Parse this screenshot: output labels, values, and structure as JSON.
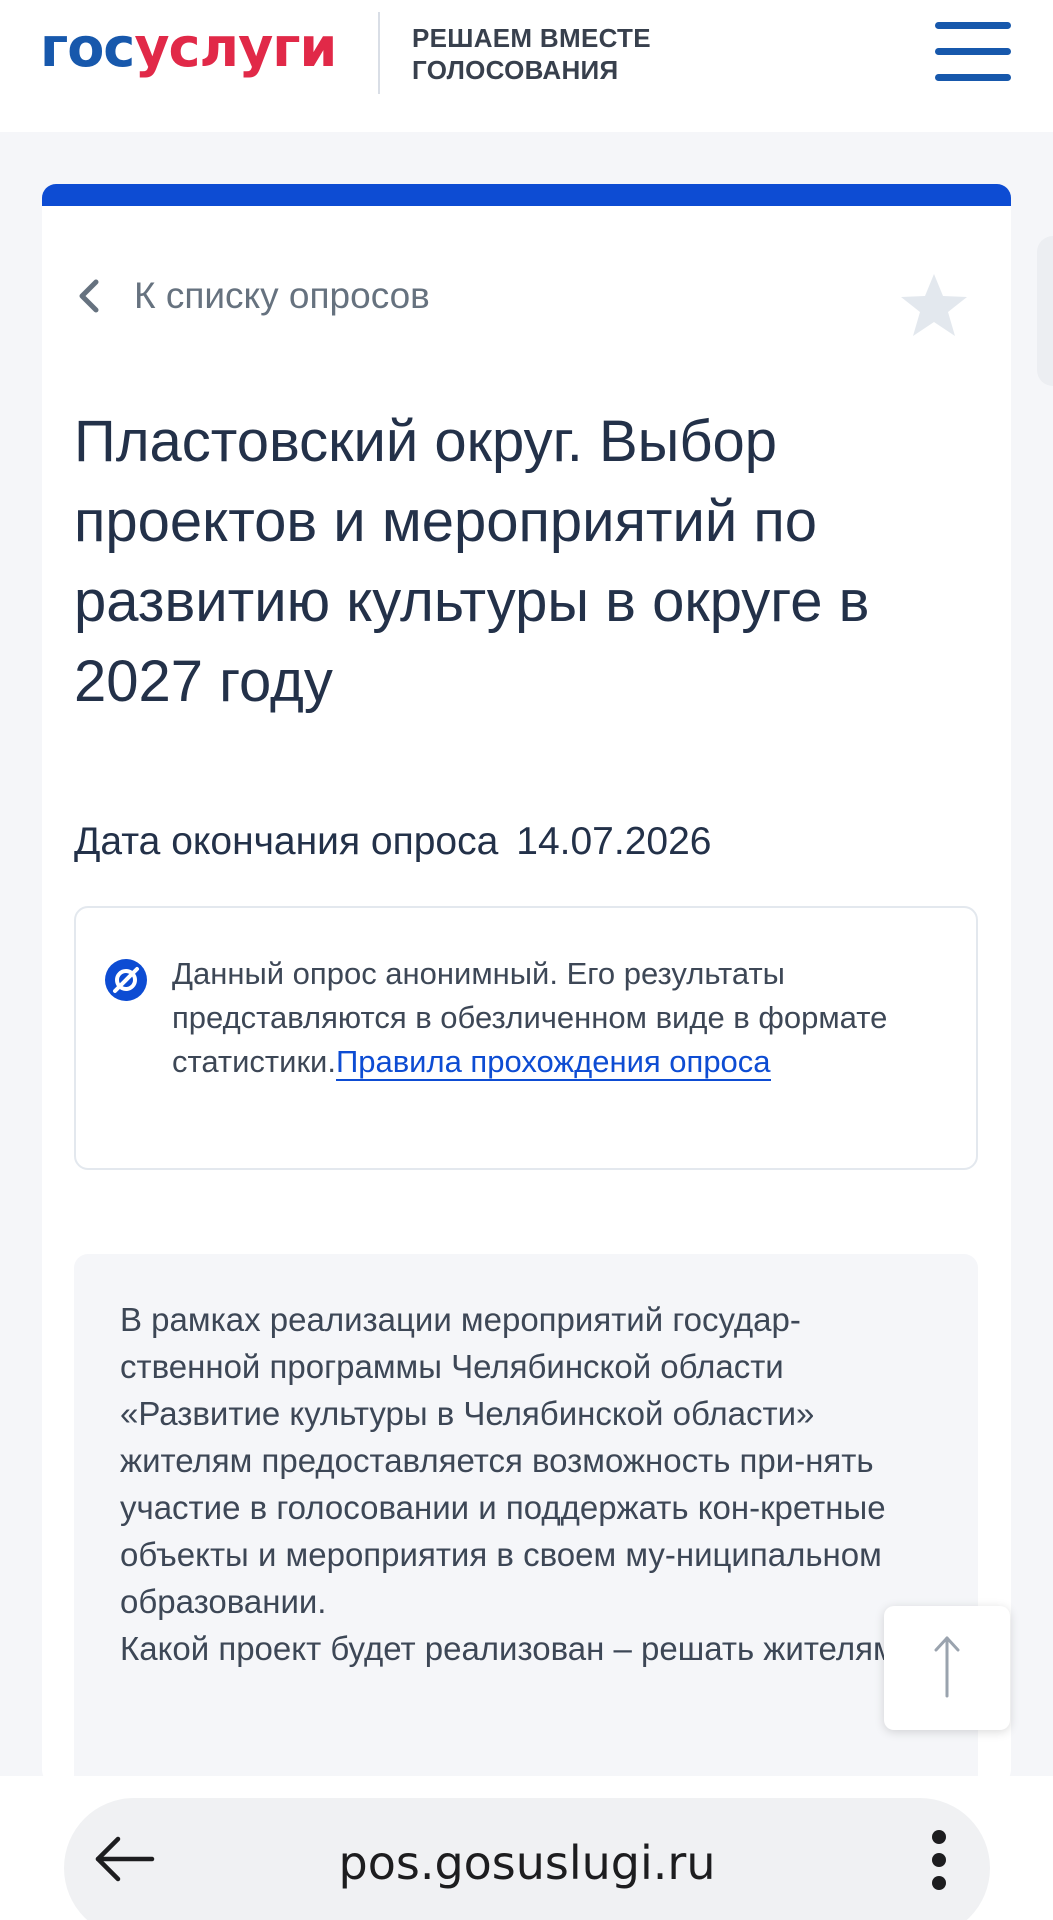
{
  "header": {
    "logo_part1": "гос",
    "logo_part2": "услуги",
    "tagline_line1": "РЕШАЕМ ВМЕСТЕ",
    "tagline_line2": "ГОЛОСОВАНИЯ"
  },
  "survey": {
    "back_label": "К списку опросов",
    "title": "Пластовский округ. Выбор проектов и мероприятий по развитию культуры в округе в 2027 году",
    "date_label": "Дата окончания опроса",
    "date_value": "14.07.2026",
    "info_text": "Данный опрос анонимный. Его результаты представляются в обезличенном виде в формате статистики.",
    "info_link": "Правила прохождения опроса",
    "description": "В рамках реализации мероприятий государ-ственной программы Челябинской области «Развитие культуры в Челябинской области» жителям предоставляется возможность при-нять участие в голосовании и поддержать кон-кретные объекты и мероприятия в своем му-ниципальном образовании.\nКакой проект будет реализован – решать жителям!"
  },
  "browser": {
    "url": "pos.gosuslugi.ru"
  },
  "colors": {
    "brand_blue": "#1758ac",
    "brand_red": "#e12948",
    "accent": "#0d4cd3",
    "text": "#233149"
  },
  "icons": [
    "menu-icon",
    "chevron-left-icon",
    "star-icon",
    "anonymous-icon",
    "arrow-up-icon",
    "arrow-left-icon",
    "more-vertical-icon"
  ]
}
